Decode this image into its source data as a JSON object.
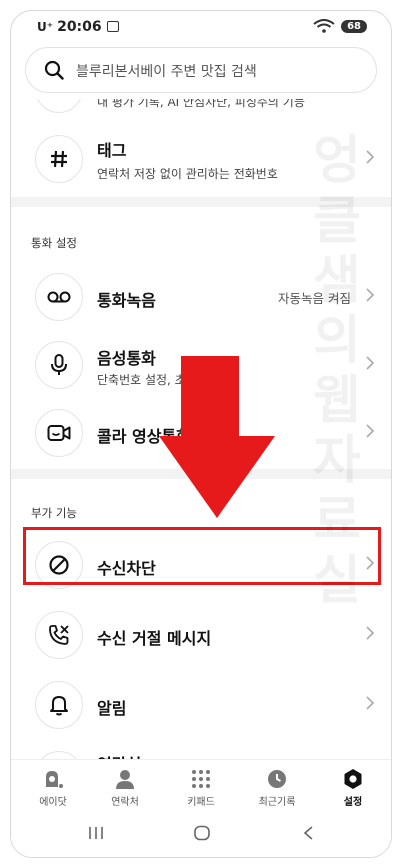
{
  "status": {
    "carrier": "U⁺",
    "time": "20:06",
    "battery": "68"
  },
  "search": {
    "placeholder": "블루리본서베이 주변 맛집 검색"
  },
  "partial_row": {
    "subtitle": "내 평가 기록, AI 안심차단, 피싱주의 기능"
  },
  "rows": [
    {
      "title": "태그",
      "subtitle": "연락처 저장 없이 관리하는 전화번호",
      "icon": "hash-icon"
    },
    {
      "title": "통화녹음",
      "value": "자동녹음 켜짐",
      "icon": "voicemail-icon"
    },
    {
      "title": "음성통화",
      "subtitle": "단축번호 설정, 초성 배열",
      "icon": "mic-icon"
    },
    {
      "title": "콜라 영상통화",
      "icon": "video-icon"
    },
    {
      "title": "수신차단",
      "icon": "block-icon"
    },
    {
      "title": "수신 거절 메시지",
      "icon": "phone-reject-icon"
    },
    {
      "title": "알림",
      "icon": "bell-icon"
    },
    {
      "title": "연락처",
      "icon": "contact-icon"
    }
  ],
  "sections": {
    "call_settings": "통화 설정",
    "extra_features": "부가 기능"
  },
  "watermark": "엉클샘의웹자료실",
  "tabs": [
    {
      "label": "에이닷",
      "icon": "adot-icon",
      "active": false
    },
    {
      "label": "연락처",
      "icon": "person-icon",
      "active": false
    },
    {
      "label": "키패드",
      "icon": "keypad-icon",
      "active": false
    },
    {
      "label": "최근기록",
      "icon": "clock-icon",
      "active": false
    },
    {
      "label": "설정",
      "icon": "settings-icon",
      "active": true
    }
  ],
  "colors": {
    "highlight": "#e61a1a",
    "arrow": "#e61a1a"
  }
}
